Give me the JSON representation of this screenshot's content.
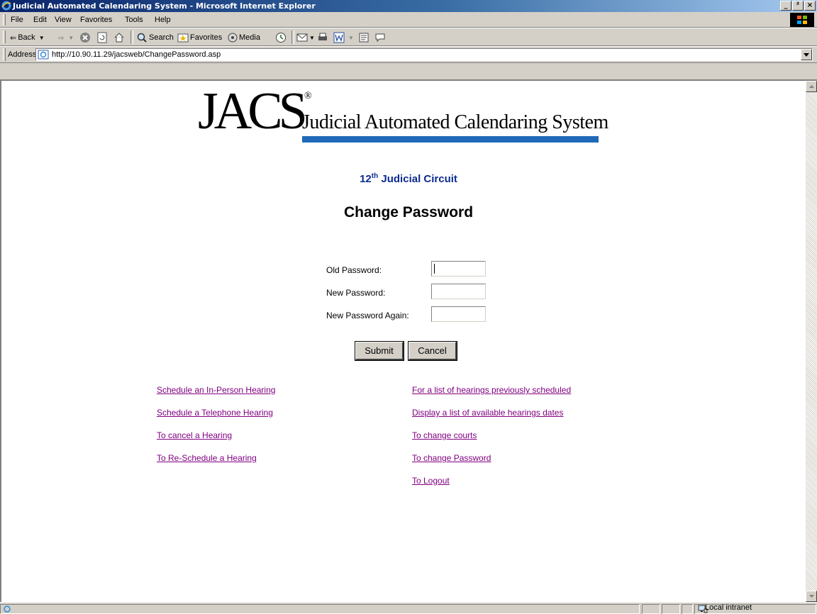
{
  "window": {
    "title": "Judicial Automated Calendaring System - Microsoft Internet Explorer",
    "minimize": "_",
    "maximize": "²",
    "close": "×"
  },
  "menu": [
    "File",
    "Edit",
    "View",
    "Favorites",
    "Tools",
    "Help"
  ],
  "toolbar": {
    "back": "Back",
    "search": "Search",
    "favorites": "Favorites",
    "media": "Media"
  },
  "address": {
    "label": "Address",
    "url": "http://10.90.11.29/jacsweb/ChangePassword.asp"
  },
  "logo": {
    "mark": "JACS",
    "registered": "®",
    "name": "Judicial Automated Calendaring System"
  },
  "circuit": {
    "number": "12",
    "ordinal": "th",
    "text": "Judicial Circuit"
  },
  "page_title": "Change Password",
  "form": {
    "old_password_label": "Old Password:",
    "new_password_label": "New Password:",
    "new_password_again_label": "New Password Again:",
    "submit": "Submit",
    "cancel": "Cancel"
  },
  "links_left": [
    "Schedule an In-Person Hearing",
    "Schedule a Telephone Hearing",
    "To cancel a Hearing",
    "To Re-Schedule a Hearing"
  ],
  "links_right": [
    "For a list of hearings previously scheduled",
    "Display a list of available hearings dates",
    "To change courts",
    "To change Password",
    "To Logout"
  ],
  "status": {
    "zone": "Local intranet"
  },
  "colors": {
    "title_gradient_start": "#0a246a",
    "circuit_blue": "#0b2b8f",
    "logo_bar": "#1f69b8",
    "visited_link": "#800080"
  }
}
